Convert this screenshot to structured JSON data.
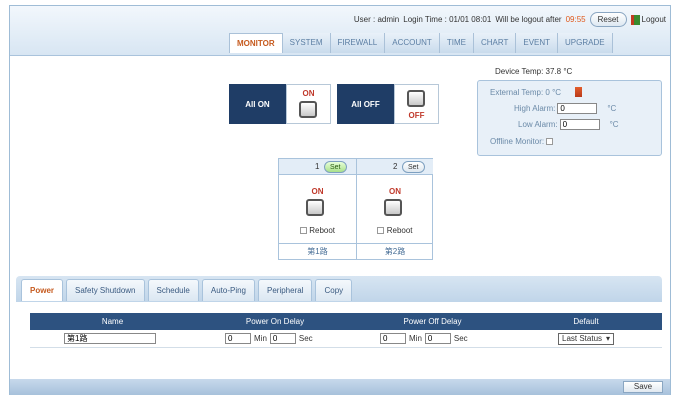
{
  "header": {
    "user_text": "User : admin",
    "login_time_text": "Login Time : 01/01 08:01",
    "logout_after_text": "Will be logout after",
    "logout_timer": "09:55",
    "reset_label": "Reset",
    "logout_label": "Logout",
    "nav": [
      "MONITOR",
      "SYSTEM",
      "FIREWALL",
      "ACCOUNT",
      "TIME",
      "CHART",
      "EVENT",
      "UPGRADE"
    ]
  },
  "power": {
    "all_on_label": "All ON",
    "on_label": "ON",
    "all_off_label": "All OFF",
    "off_label": "OFF"
  },
  "temperature": {
    "device_temp": "Device Temp: 37.8 °C",
    "external_temp": "External Temp: 0 °C",
    "high_alarm_label": "High Alarm:",
    "high_alarm_value": "0",
    "low_alarm_label": "Low Alarm:",
    "low_alarm_value": "0",
    "unit": "°C",
    "offline_monitor_label": "Offline Monitor:"
  },
  "outlets": [
    {
      "number": "1",
      "set_label": "Set",
      "state_label": "ON",
      "reboot_label": "Reboot",
      "name": "第1路"
    },
    {
      "number": "2",
      "set_label": "Set",
      "state_label": "ON",
      "reboot_label": "Reboot",
      "name": "第2路"
    }
  ],
  "tabs": [
    "Power",
    "Safety Shutdown",
    "Schedule",
    "Auto-Ping",
    "Peripheral",
    "Copy"
  ],
  "settings": {
    "headers": [
      "Name",
      "Power On Delay",
      "Power Off Delay",
      "Default"
    ],
    "row": {
      "name": "第1路",
      "on_min": "0",
      "min_label": "Min",
      "on_sec": "0",
      "sec_label": "Sec",
      "off_min": "0",
      "off_sec": "0",
      "default": "Last Status"
    }
  },
  "footer": {
    "save_label": "Save"
  }
}
